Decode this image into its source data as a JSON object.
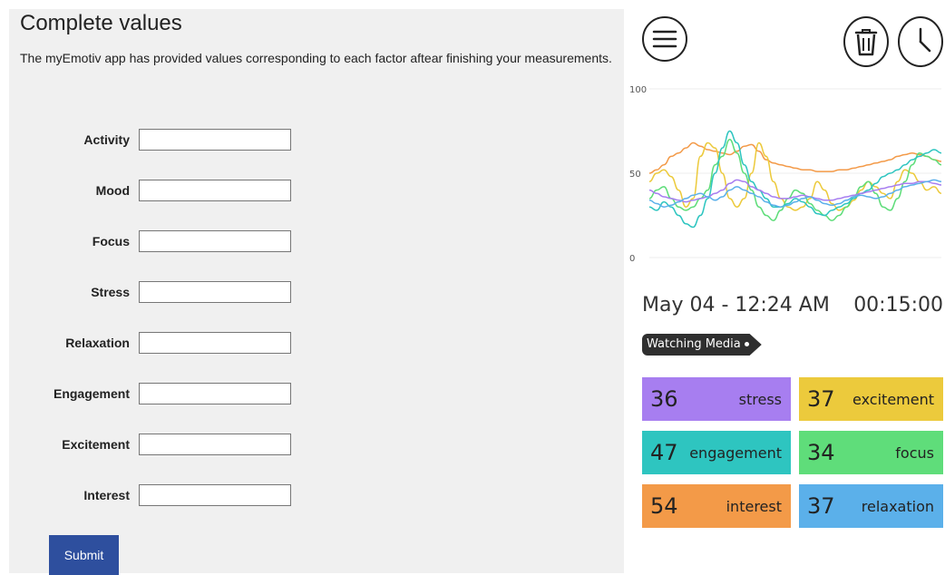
{
  "form": {
    "title": "Complete values",
    "description": "The myEmotiv app has provided values corresponding to each factor aftear finishing your measurements.",
    "fields": [
      {
        "label": "Activity",
        "value": ""
      },
      {
        "label": "Mood",
        "value": ""
      },
      {
        "label": "Focus",
        "value": ""
      },
      {
        "label": "Stress",
        "value": ""
      },
      {
        "label": "Relaxation",
        "value": ""
      },
      {
        "label": "Engagement",
        "value": ""
      },
      {
        "label": "Excitement",
        "value": ""
      },
      {
        "label": "Interest",
        "value": ""
      }
    ],
    "submit_label": "Submit",
    "colors": {
      "panel_bg": "#f0f0f0",
      "submit_bg": "#2e4f9e"
    }
  },
  "app": {
    "icons": [
      "menu-icon",
      "trash-icon",
      "pie-chart-icon"
    ],
    "session": {
      "date": "May 04 - 12:24 AM",
      "duration": "00:15:00",
      "activity": "Watching Media"
    },
    "metrics": [
      {
        "value": "36",
        "name": "stress",
        "color": "#a77ef0"
      },
      {
        "value": "37",
        "name": "excitement",
        "color": "#ecca3c"
      },
      {
        "value": "47",
        "name": "engagement",
        "color": "#2ec5c0"
      },
      {
        "value": "34",
        "name": "focus",
        "color": "#5fdd7a"
      },
      {
        "value": "54",
        "name": "interest",
        "color": "#f39a48"
      },
      {
        "value": "37",
        "name": "relaxation",
        "color": "#5bb0ea"
      }
    ]
  },
  "chart_data": {
    "type": "line",
    "ylim": [
      0,
      100
    ],
    "yticks": [
      "100",
      "50",
      "0"
    ],
    "x": [
      0,
      1,
      2,
      3,
      4,
      5,
      6,
      7,
      8,
      9,
      10,
      11,
      12,
      13,
      14,
      15,
      16,
      17,
      18,
      19,
      20,
      21,
      22,
      23,
      24,
      25,
      26,
      27,
      28,
      29,
      30,
      31,
      32,
      33,
      34,
      35,
      36,
      37,
      38,
      39,
      40
    ],
    "series": [
      {
        "color": "#f39a48",
        "values": [
          50,
          52,
          55,
          60,
          62,
          65,
          68,
          66,
          64,
          63,
          62,
          61,
          63,
          66,
          67,
          63,
          58,
          56,
          55,
          54,
          53,
          52,
          52,
          51,
          51,
          51,
          52,
          52,
          53,
          54,
          55,
          56,
          57,
          58,
          60,
          61,
          62,
          61,
          60,
          58,
          57
        ]
      },
      {
        "color": "#ecca3c",
        "values": [
          45,
          50,
          52,
          48,
          40,
          30,
          35,
          60,
          68,
          65,
          50,
          35,
          30,
          35,
          50,
          68,
          60,
          45,
          35,
          30,
          28,
          30,
          35,
          45,
          40,
          32,
          28,
          30,
          34,
          40,
          45,
          42,
          38,
          35,
          45,
          52,
          50,
          45,
          40,
          42,
          38
        ]
      },
      {
        "color": "#5fdd7a",
        "values": [
          35,
          40,
          42,
          35,
          30,
          28,
          30,
          35,
          40,
          55,
          60,
          70,
          62,
          50,
          40,
          30,
          25,
          22,
          28,
          35,
          40,
          38,
          32,
          28,
          25,
          22,
          25,
          30,
          36,
          42,
          45,
          38,
          30,
          28,
          35,
          45,
          55,
          62,
          60,
          58,
          55
        ]
      },
      {
        "color": "#2ec5c0",
        "values": [
          30,
          28,
          33,
          30,
          25,
          20,
          18,
          25,
          35,
          50,
          65,
          75,
          68,
          55,
          45,
          40,
          35,
          30,
          30,
          32,
          35,
          33,
          30,
          26,
          25,
          28,
          30,
          32,
          35,
          38,
          40,
          44,
          48,
          50,
          52,
          55,
          58,
          60,
          62,
          64,
          62
        ]
      },
      {
        "color": "#a77ef0",
        "values": [
          40,
          38,
          36,
          35,
          34,
          33,
          34,
          35,
          36,
          38,
          40,
          44,
          46,
          45,
          42,
          40,
          38,
          36,
          35,
          35,
          36,
          37,
          36,
          35,
          34,
          34,
          35,
          36,
          37,
          38,
          39,
          40,
          41,
          42,
          43,
          44,
          44,
          45,
          45,
          44,
          43
        ]
      },
      {
        "color": "#5bb0ea",
        "values": [
          34,
          32,
          30,
          31,
          33,
          35,
          37,
          38,
          36,
          34,
          36,
          40,
          42,
          40,
          38,
          36,
          33,
          31,
          30,
          31,
          33,
          35,
          36,
          34,
          32,
          31,
          32,
          34,
          36,
          37,
          36,
          35,
          36,
          38,
          40,
          42,
          43,
          44,
          45,
          46,
          45
        ]
      }
    ]
  }
}
